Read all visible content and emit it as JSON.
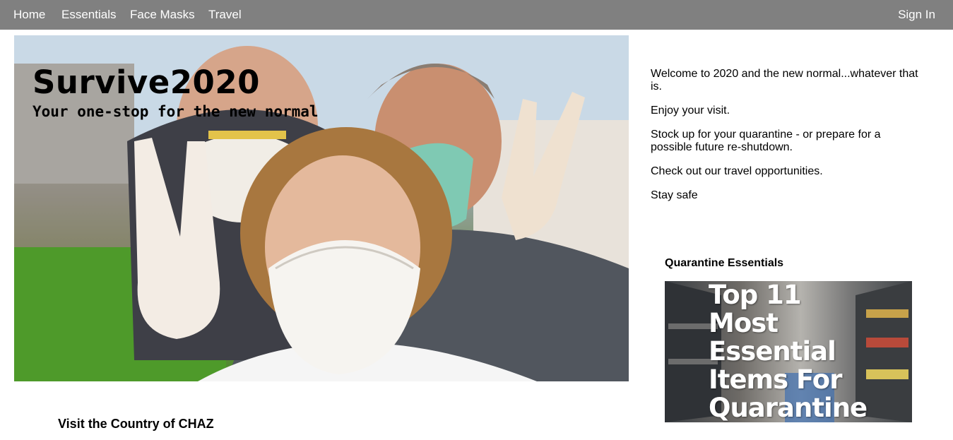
{
  "nav": {
    "home": "Home",
    "essentials": "Essentials",
    "face_masks": "Face Masks",
    "travel": "Travel",
    "sign_in": "Sign In"
  },
  "hero": {
    "title": "Survive2020",
    "subtitle": "Your one-stop for the new normal"
  },
  "intro": {
    "lines": [
      "Welcome to 2020 and the new normal...whatever that is.",
      "Enjoy your visit.",
      "Stock up for your quarantine - or prepare for a possible future re-shutdown.",
      "Check out our travel opportunities.",
      "Stay safe"
    ]
  },
  "essentials": {
    "heading": "Quarantine Essentials",
    "image_text_lines": [
      "Top 11",
      "Most",
      "Essential",
      "Items For",
      "Quarantine"
    ]
  },
  "travel_section": {
    "heading": "Visit the Country of CHAZ"
  },
  "colors": {
    "nav_bg": "#808080",
    "nav_text": "#ffffff",
    "page_bg": "#ffffff"
  }
}
